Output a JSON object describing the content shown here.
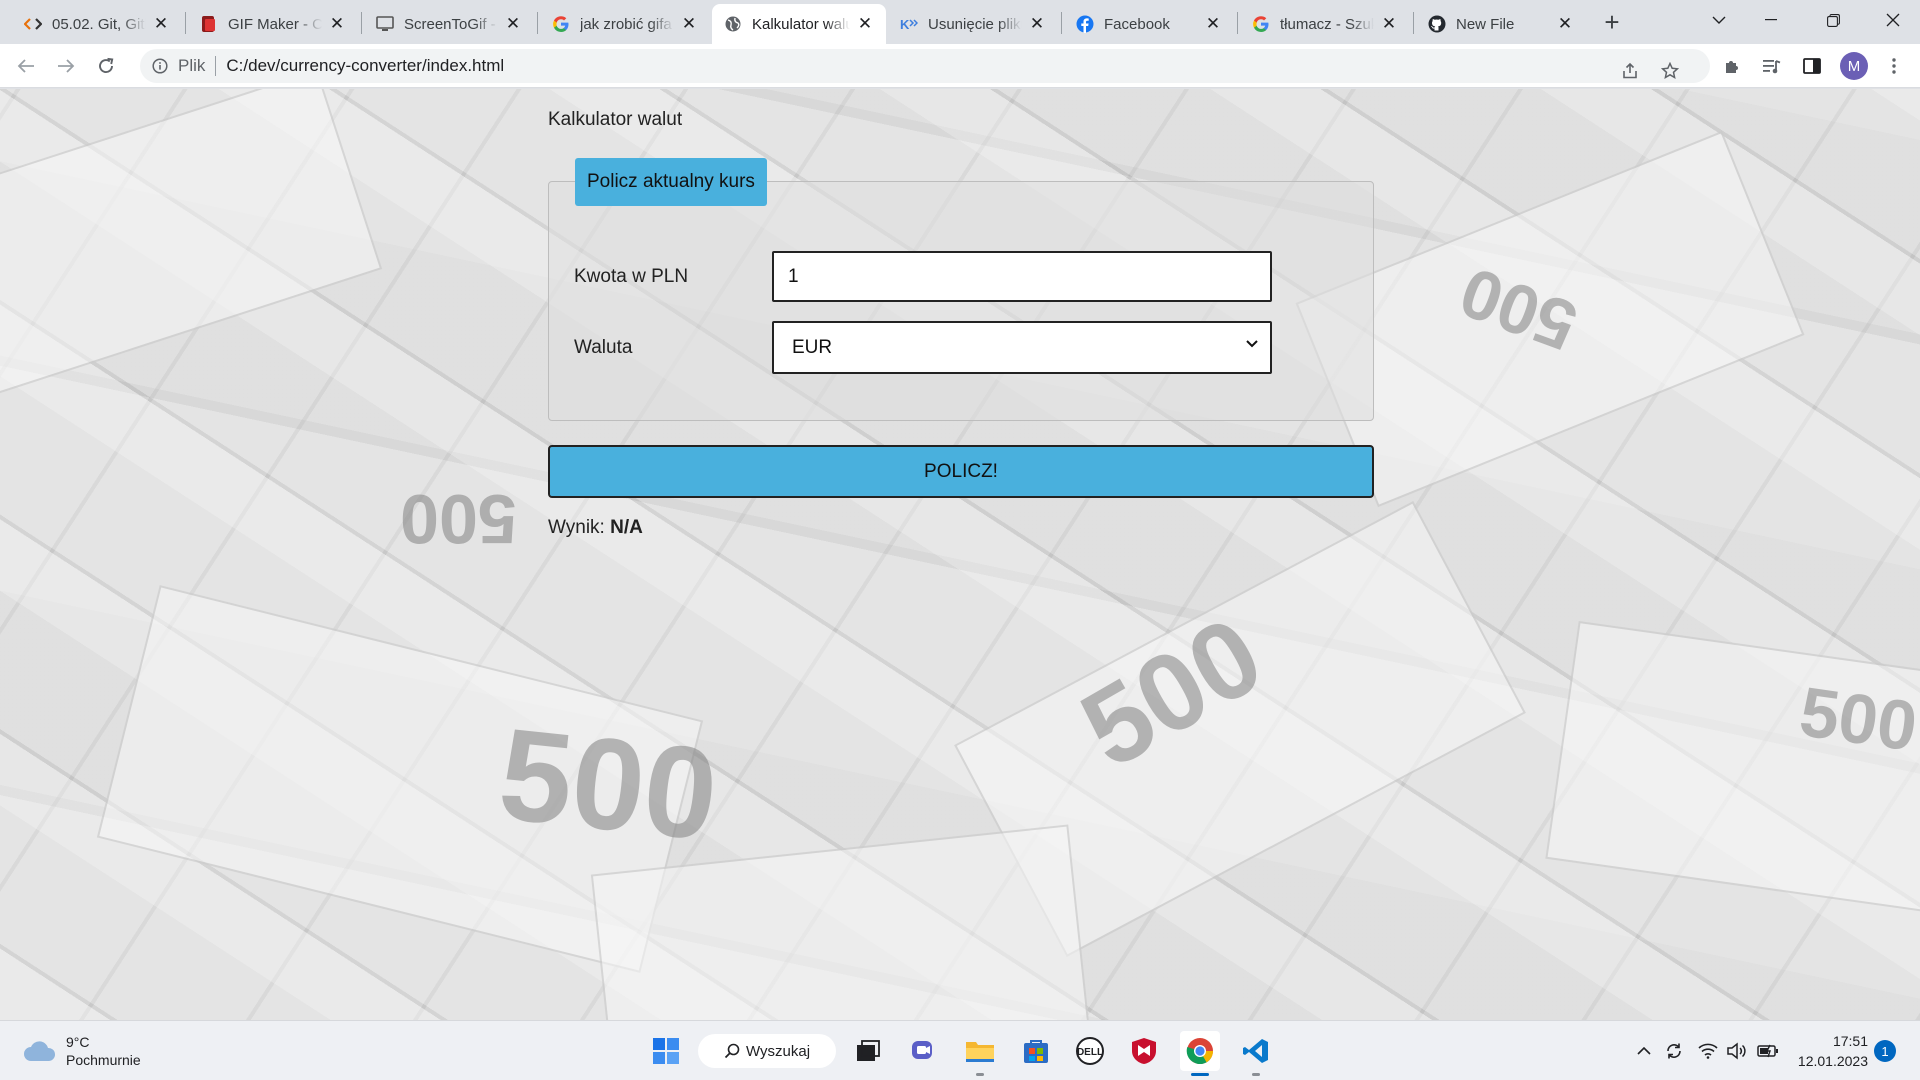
{
  "browser": {
    "tabs": [
      {
        "title": "05.02. Git, Github",
        "icon": "code-icon",
        "active": false
      },
      {
        "title": "GIF Maker - Cr",
        "icon": "gif-maker-icon",
        "active": false
      },
      {
        "title": "ScreenToGif - ",
        "icon": "monitor-icon",
        "active": false
      },
      {
        "title": "jak zrobić gifa",
        "icon": "google-icon",
        "active": false
      },
      {
        "title": "Kalkulator walut",
        "icon": "globe-icon",
        "active": true
      },
      {
        "title": "Usunięcie pliku",
        "icon": "kodilla-icon",
        "active": false
      },
      {
        "title": "Facebook",
        "icon": "facebook-icon",
        "active": false
      },
      {
        "title": "tłumacz - Szuk",
        "icon": "google-icon",
        "active": false
      },
      {
        "title": "New File",
        "icon": "github-icon",
        "active": false
      }
    ],
    "new_tab_label": "+",
    "address": {
      "scheme_label": "Plik",
      "url": "C:/dev/currency-converter/index.html"
    },
    "profile_initial": "M"
  },
  "page": {
    "app_title": "Kalkulator walut",
    "legend": "Policz aktualny kurs",
    "amount_label": "Kwota w PLN",
    "amount_value": "1",
    "currency_label": "Waluta",
    "currency_selected": "EUR",
    "calc_button": "POLICZ!",
    "result_label": "Wynik:",
    "result_value": "N/A"
  },
  "taskbar": {
    "weather_temp": "9°C",
    "weather_desc": "Pochmurnie",
    "search_label": "Wyszukaj",
    "time": "17:51",
    "date": "12.01.2023",
    "notification_count": "1"
  },
  "colors": {
    "accent_blue": "#49b0dd",
    "windows_blue": "#0067c0",
    "avatar": "#6b5fb5"
  }
}
